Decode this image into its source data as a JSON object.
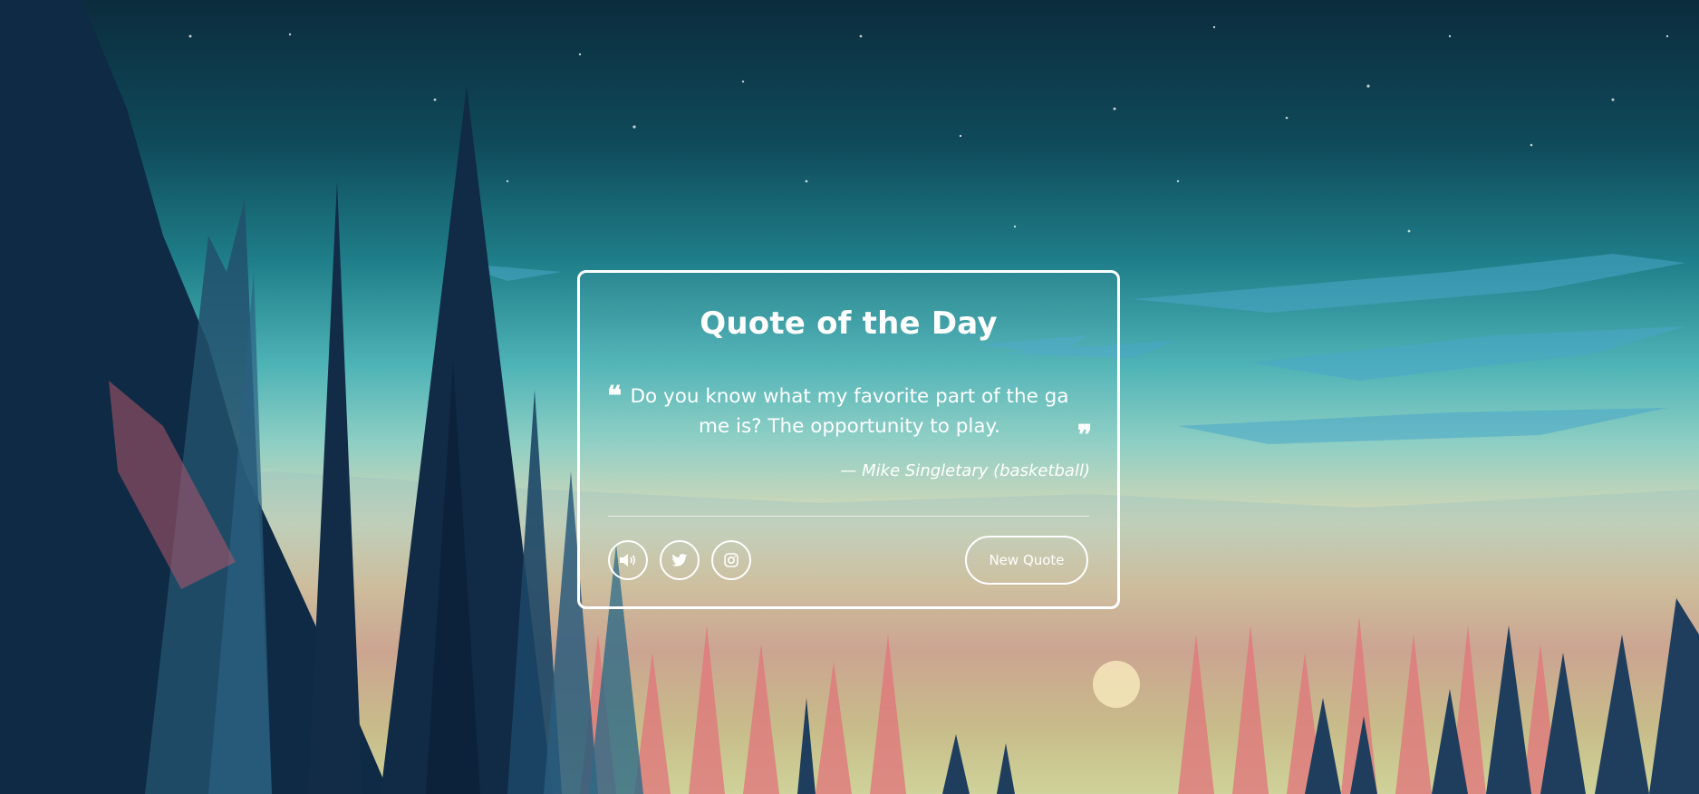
{
  "card": {
    "title": "Quote of the Day",
    "quote_open_mark": "❝",
    "quote_close_mark": "❞",
    "quote_text": "Do you know what my favorite part of the game is? The opportunity to play.",
    "author": "— Mike Singletary (basketball)",
    "new_quote_label": "New Quote"
  },
  "icons": {
    "speak": "volume-icon",
    "twitter": "twitter-icon",
    "instagram": "instagram-icon"
  },
  "colors": {
    "card_border": "#ffffff",
    "text": "#ffffff"
  }
}
